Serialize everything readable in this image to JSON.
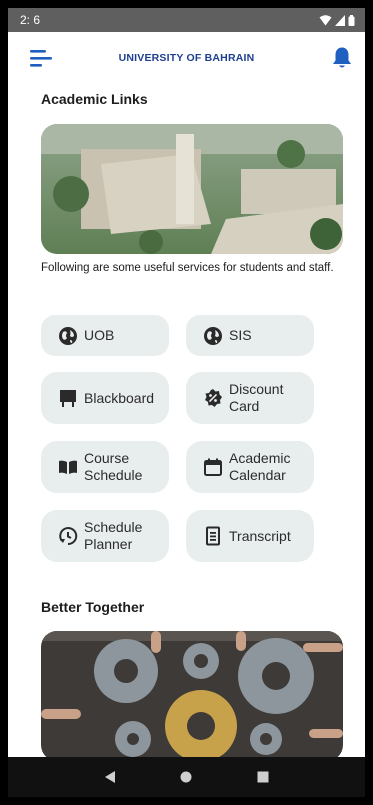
{
  "status_bar": {
    "time": "2: 6"
  },
  "header": {
    "title": "UNIVERSITY OF BAHRAIN"
  },
  "sections": {
    "academic_links": "Academic Links",
    "intro": "Following are some useful services for students and staff.",
    "better_together": "Better Together"
  },
  "links": [
    {
      "label": "UOB",
      "icon": "globe-icon"
    },
    {
      "label": "SIS",
      "icon": "globe-icon"
    },
    {
      "label": "Blackboard",
      "icon": "chalkboard-icon"
    },
    {
      "label": "Discount\nCard",
      "icon": "badge-percent-icon"
    },
    {
      "label": "Course\nSchedule",
      "icon": "book-open-icon"
    },
    {
      "label": "Academic\nCalendar",
      "icon": "calendar-icon"
    },
    {
      "label": "Schedule\nPlanner",
      "icon": "clock-refresh-icon"
    },
    {
      "label": "Transcript",
      "icon": "document-list-icon"
    }
  ],
  "colors": {
    "accent": "#1f3f8f",
    "button_bg": "#e8eded",
    "status_bar": "#5f5f5f"
  }
}
